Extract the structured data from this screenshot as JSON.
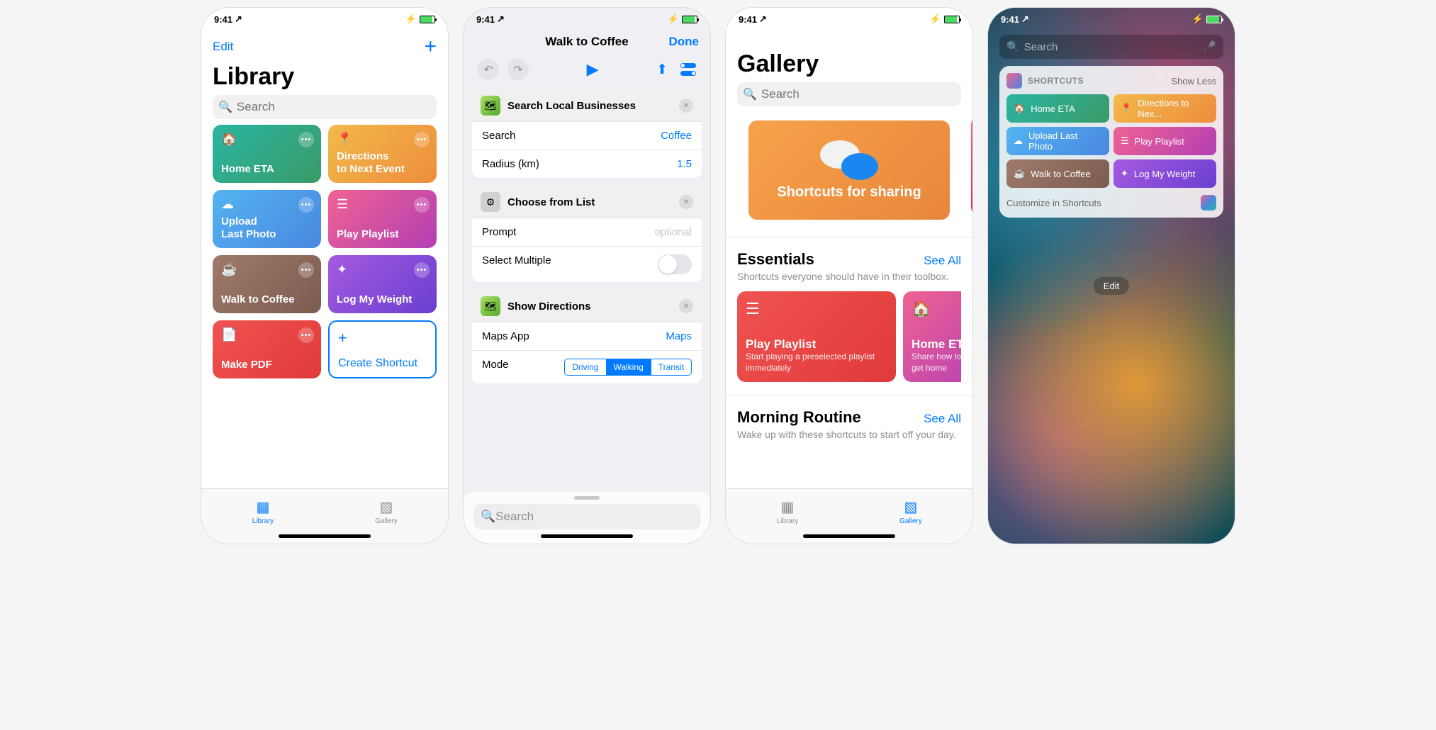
{
  "status": {
    "time": "9:41",
    "location_arrow": "↗"
  },
  "library": {
    "edit": "Edit",
    "title": "Library",
    "search_placeholder": "Search",
    "tiles": [
      {
        "label": "Home ETA",
        "grad": "g-green",
        "icon": "home"
      },
      {
        "label": "Directions\nto Next Event",
        "grad": "g-orange",
        "icon": "pin"
      },
      {
        "label": "Upload\nLast Photo",
        "grad": "g-blue",
        "icon": "cloud"
      },
      {
        "label": "Play Playlist",
        "grad": "g-pink",
        "icon": "list"
      },
      {
        "label": "Walk to Coffee",
        "grad": "g-brown",
        "icon": "cup"
      },
      {
        "label": "Log My Weight",
        "grad": "g-purple",
        "icon": "person"
      },
      {
        "label": "Make PDF",
        "grad": "g-red",
        "icon": "doc"
      }
    ],
    "create": "Create Shortcut",
    "tabs": {
      "library": "Library",
      "gallery": "Gallery"
    }
  },
  "editor": {
    "title": "Walk to Coffee",
    "done": "Done",
    "blocks": [
      {
        "name": "Search Local Businesses",
        "icon": "maps",
        "rows": [
          {
            "label": "Search",
            "value": "Coffee",
            "type": "link"
          },
          {
            "label": "Radius (km)",
            "value": "1.5",
            "type": "link"
          }
        ]
      },
      {
        "name": "Choose from List",
        "icon": "gear",
        "rows": [
          {
            "label": "Prompt",
            "value": "optional",
            "type": "placeholder"
          },
          {
            "label": "Select Multiple",
            "type": "switch"
          }
        ]
      },
      {
        "name": "Show Directions",
        "icon": "maps",
        "rows": [
          {
            "label": "Maps App",
            "value": "Maps",
            "type": "link"
          },
          {
            "label": "Mode",
            "type": "segment",
            "options": [
              "Driving",
              "Walking",
              "Transit"
            ],
            "selected": "Walking"
          }
        ]
      }
    ],
    "search_placeholder": "Search"
  },
  "gallery": {
    "title": "Gallery",
    "search_placeholder": "Search",
    "banner": "Shortcuts for sharing",
    "sections": [
      {
        "title": "Essentials",
        "see_all": "See All",
        "sub": "Shortcuts everyone should have in their toolbox.",
        "cards": [
          {
            "title": "Play Playlist",
            "sub": "Start playing a preselected playlist immediately",
            "grad": "g-red",
            "icon": "list",
            "small": false
          },
          {
            "title": "Home ETA",
            "sub": "Share how long to get home",
            "grad": "g-pink",
            "icon": "home",
            "small": true
          }
        ]
      },
      {
        "title": "Morning Routine",
        "see_all": "See All",
        "sub": "Wake up with these shortcuts to start off your day."
      }
    ],
    "tabs": {
      "library": "Library",
      "gallery": "Gallery"
    }
  },
  "widget": {
    "search_placeholder": "Search",
    "title": "SHORTCUTS",
    "show_less": "Show Less",
    "tiles": [
      {
        "label": "Home ETA",
        "grad": "g-green",
        "icon": "home"
      },
      {
        "label": "Directions to Nex...",
        "grad": "g-orange",
        "icon": "pin"
      },
      {
        "label": "Upload Last Photo",
        "grad": "g-blue",
        "icon": "cloud"
      },
      {
        "label": "Play Playlist",
        "grad": "g-pink",
        "icon": "list"
      },
      {
        "label": "Walk to Coffee",
        "grad": "g-brown",
        "icon": "cup"
      },
      {
        "label": "Log My Weight",
        "grad": "g-purple",
        "icon": "person"
      }
    ],
    "customize": "Customize in Shortcuts",
    "edit_pill": "Edit"
  },
  "icons": {
    "home": "⌂",
    "pin": "📍",
    "cloud": "☁",
    "list": "≡",
    "cup": "☕",
    "person": "✦",
    "doc": "📄",
    "gear": "⚙",
    "maps": "🗺"
  }
}
